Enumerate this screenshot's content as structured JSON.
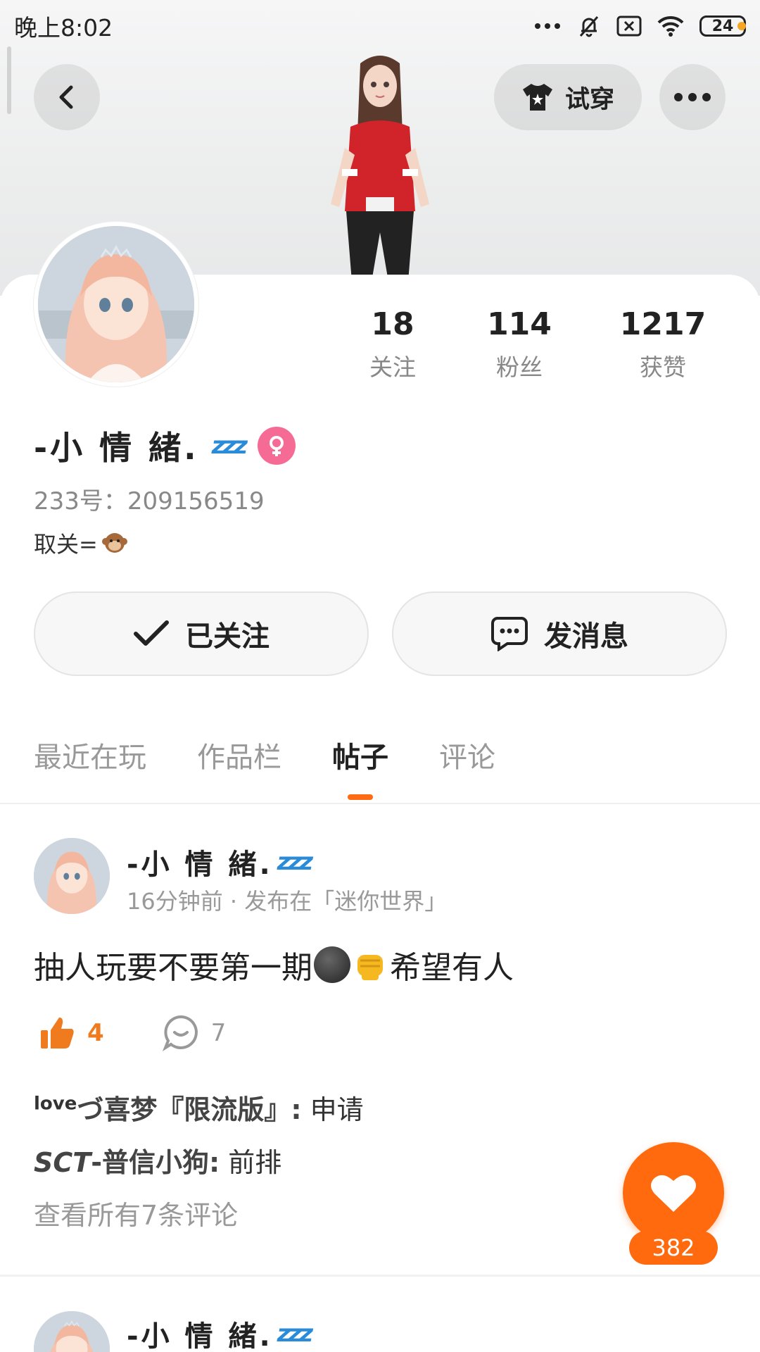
{
  "status_bar": {
    "time": "晚上8:02",
    "battery": "24"
  },
  "header": {
    "try_on_label": "试穿"
  },
  "profile": {
    "stats": [
      {
        "value": "18",
        "label": "关注"
      },
      {
        "value": "114",
        "label": "粉丝"
      },
      {
        "value": "1217",
        "label": "获赞"
      }
    ],
    "username": "-小 情 緒.",
    "zzz": "zzz",
    "uid": "233号：209156519",
    "bio_text": "取关=",
    "follow_label": "已关注",
    "message_label": "发消息"
  },
  "tabs": [
    {
      "label": "最近在玩",
      "active": false
    },
    {
      "label": "作品栏",
      "active": false
    },
    {
      "label": "帖子",
      "active": true
    },
    {
      "label": "评论",
      "active": false
    }
  ],
  "post": {
    "author": "-小 情 緒.",
    "meta": "16分钟前 · 发布在「迷你世界」",
    "text_before": "抽人玩要不要第一期",
    "text_after": "希望有人",
    "likes": "4",
    "comments": "7",
    "comment_list": [
      {
        "prefix": "love",
        "author": "づ喜梦『限流版』:",
        "text": " 申请"
      },
      {
        "prefix": "SCT",
        "author": "-普信小狗:",
        "text": " 前排"
      }
    ],
    "view_all": "查看所有7条评论"
  },
  "fab": {
    "count": "382"
  },
  "next_post": {
    "author": "-小 情 緒."
  },
  "colors": {
    "accent": "#ff6a0f",
    "like": "#f07a1e",
    "gender": "#f56b95"
  }
}
